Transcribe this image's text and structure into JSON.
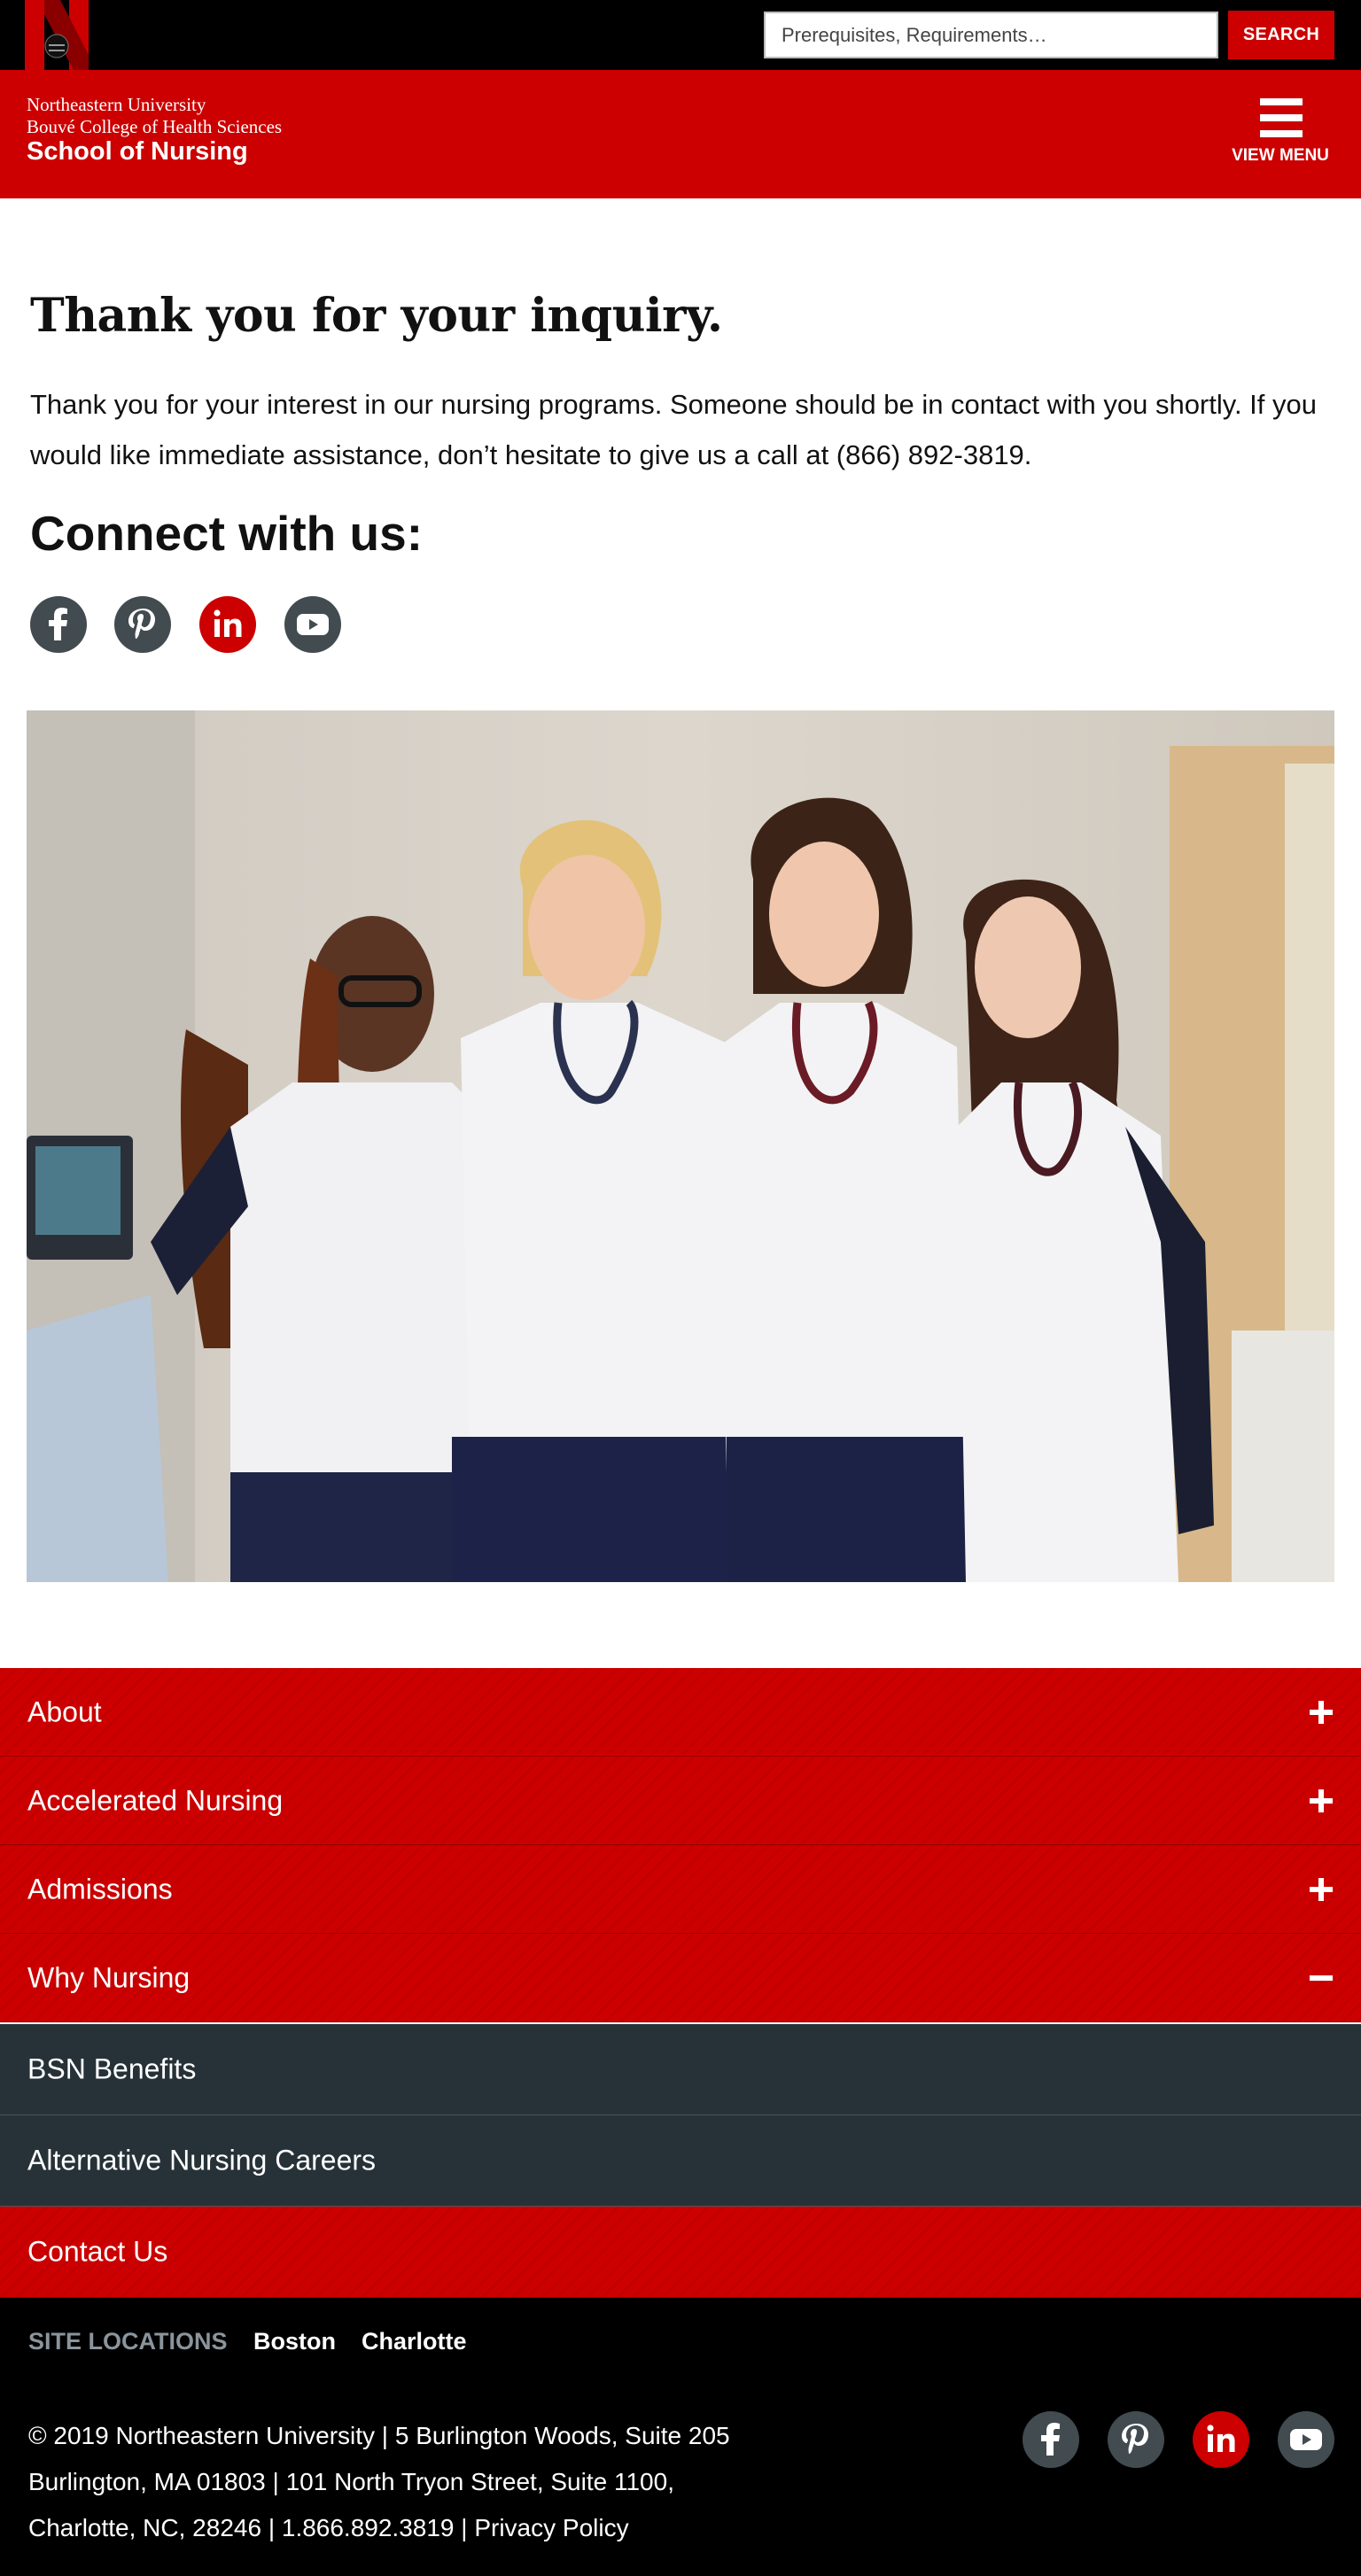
{
  "search": {
    "placeholder": "Prerequisites, Requirements…",
    "button_label": "SEARCH"
  },
  "header": {
    "brand_line1": "Northeastern University",
    "brand_line2": "Bouvé College of Health Sciences",
    "brand_line3": "School of Nursing",
    "menu_label": "VIEW MENU"
  },
  "main": {
    "title": "Thank you for your inquiry.",
    "intro": "Thank you for your interest in our nursing programs. Someone should be in contact with you shortly. If you would like immediate assistance, don’t hesitate to give us a call at (866) 892-3819.",
    "connect_heading": "Connect with us:"
  },
  "social": [
    {
      "name": "facebook-icon",
      "color": "#424b50"
    },
    {
      "name": "pinterest-icon",
      "color": "#424b50"
    },
    {
      "name": "linkedin-icon",
      "color": "#cc0000"
    },
    {
      "name": "youtube-icon",
      "color": "#424b50"
    }
  ],
  "nav": {
    "items": [
      {
        "label": "About",
        "state": "collapsed"
      },
      {
        "label": "Accelerated Nursing",
        "state": "collapsed"
      },
      {
        "label": "Admissions",
        "state": "collapsed"
      },
      {
        "label": "Why Nursing",
        "state": "expanded"
      },
      {
        "label": "BSN Benefits",
        "state": "sub-item"
      },
      {
        "label": "Alternative Nursing Careers",
        "state": "sub-item"
      },
      {
        "label": "Contact Us",
        "state": "link"
      }
    ]
  },
  "footer": {
    "locations_label": "SITE LOCATIONS",
    "locations": [
      "Boston",
      "Charlotte"
    ],
    "address": "© 2019 Northeastern University | 5 Burlington Woods, Suite 205 Burlington, MA 01803 | 101 North Tryon Street, Suite 1100, Charlotte, NC, 28246 | 1.866.892.3819 | Privacy Policy"
  },
  "colors": {
    "brand_red": "#cc0000",
    "dark_slate": "#263238",
    "icon_gray": "#424b50"
  }
}
